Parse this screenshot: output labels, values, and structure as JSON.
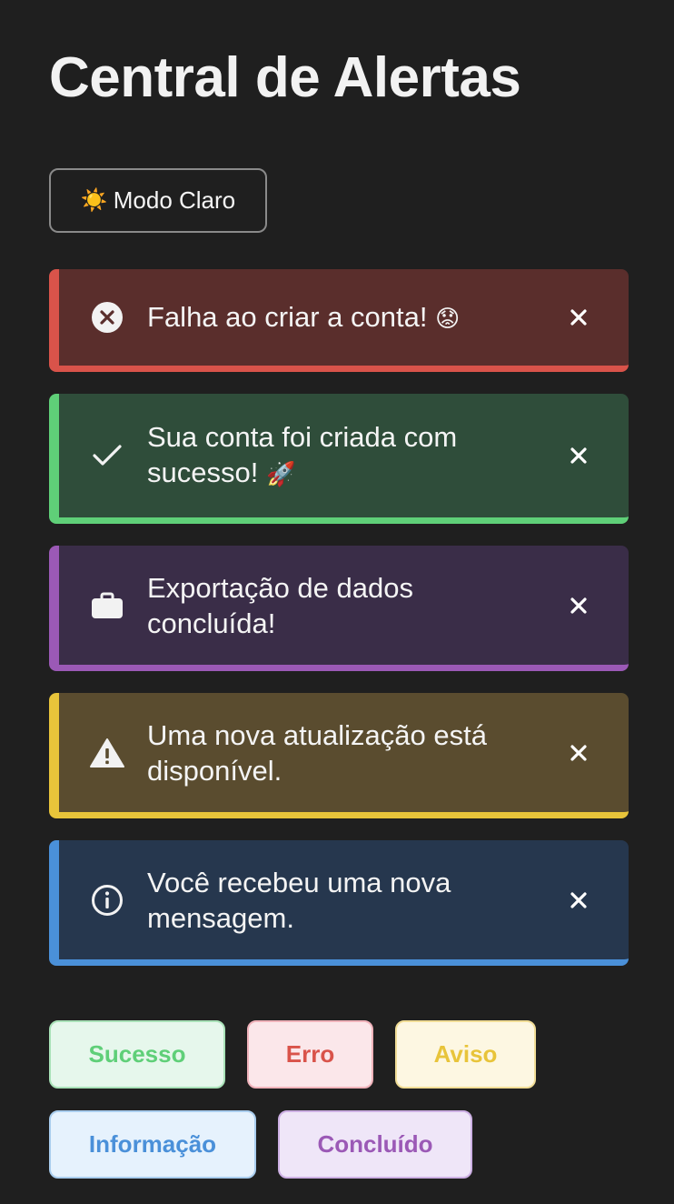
{
  "header": {
    "title": "Central de Alertas"
  },
  "theme_toggle": {
    "icon": "sun-icon",
    "glyph": "☀️",
    "label": "Modo Claro"
  },
  "alerts": [
    {
      "type": "error",
      "icon": "x-circle-icon",
      "message": "Falha ao criar a conta!",
      "emoji": "😟",
      "close_glyph": "✕",
      "accent": "#d9534a"
    },
    {
      "type": "success",
      "icon": "checkmark-icon",
      "message": "Sua conta foi criada com sucesso!",
      "emoji": "🚀",
      "close_glyph": "✕",
      "accent": "#5fcf78"
    },
    {
      "type": "done",
      "icon": "briefcase-icon",
      "message": "Exportação de dados concluída!",
      "close_glyph": "✕",
      "accent": "#9b59b6"
    },
    {
      "type": "warning",
      "icon": "warning-triangle-icon",
      "message": "Uma nova atualização está disponível.",
      "close_glyph": "✕",
      "accent": "#e8c43a"
    },
    {
      "type": "info",
      "icon": "info-circle-icon",
      "message": "Você recebeu uma nova mensagem.",
      "close_glyph": "✕",
      "accent": "#4a90d9"
    }
  ],
  "triggers": {
    "success": "Sucesso",
    "error": "Erro",
    "warning": "Aviso",
    "info": "Informação",
    "done": "Concluído"
  }
}
